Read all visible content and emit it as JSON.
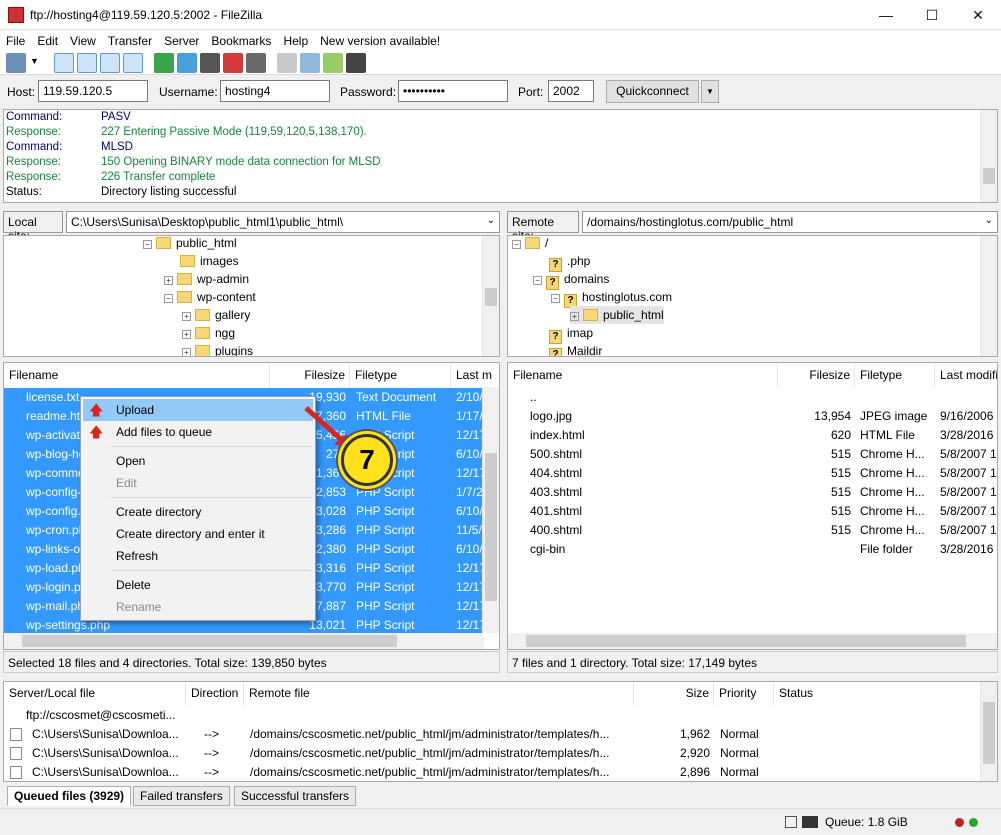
{
  "window": {
    "title": "ftp://hosting4@119.59.120.5:2002 - FileZilla",
    "minimize": "—",
    "maximize": "☐",
    "close": "✕"
  },
  "menu": [
    "File",
    "Edit",
    "View",
    "Transfer",
    "Server",
    "Bookmarks",
    "Help",
    "New version available!"
  ],
  "quickconnect": {
    "host_label": "Host:",
    "host_value": "119.59.120.5",
    "user_label": "Username:",
    "user_value": "hosting4",
    "pass_label": "Password:",
    "pass_value": "••••••••••",
    "port_label": "Port:",
    "port_value": "2002",
    "button": "Quickconnect",
    "dropdown": "▼"
  },
  "log": [
    {
      "key": "Command:",
      "text": "PASV",
      "color": "navy"
    },
    {
      "key": "Response:",
      "text": "227 Entering Passive Mode (119,59,120,5,138,170).",
      "color": "green"
    },
    {
      "key": "Command:",
      "text": "MLSD",
      "color": "navy"
    },
    {
      "key": "Response:",
      "text": "150 Opening BINARY mode data connection for MLSD",
      "color": "green"
    },
    {
      "key": "Response:",
      "text": "226 Transfer complete",
      "color": "green"
    },
    {
      "key": "Status:",
      "text": "Directory listing successful",
      "color": "black"
    }
  ],
  "local": {
    "site_label": "Local site:",
    "path": "C:\\Users\\Sunisa\\Desktop\\public_html1\\public_html\\",
    "tree": [
      "public_html",
      "images",
      "wp-admin",
      "wp-content",
      "gallery",
      "ngg",
      "plugins"
    ],
    "headers": {
      "name": "Filename",
      "size": "Filesize",
      "type": "Filetype",
      "mod": "Last m"
    },
    "files": [
      {
        "name": "license.txt",
        "size": "19,930",
        "type": "Text Document",
        "mod": "2/10/"
      },
      {
        "name": "readme.html",
        "size": "7,360",
        "type": "HTML File",
        "mod": "1/17/"
      },
      {
        "name": "wp-activate.php",
        "size": "5,456",
        "type": "PHP Script",
        "mod": "12/17"
      },
      {
        "name": "wp-blog-header.php",
        "size": "271",
        "type": "PHP Script",
        "mod": "6/10/"
      },
      {
        "name": "wp-comments-post.php",
        "size": "1,369",
        "type": "PHP Script",
        "mod": "12/17"
      },
      {
        "name": "wp-config-sample.php",
        "size": "2,853",
        "type": "PHP Script",
        "mod": "1/7/2"
      },
      {
        "name": "wp-config.php",
        "size": "3,028",
        "type": "PHP Script",
        "mod": "6/10/"
      },
      {
        "name": "wp-cron.php",
        "size": "3,286",
        "type": "PHP Script",
        "mod": "11/5/"
      },
      {
        "name": "wp-links-opml.php",
        "size": "2,380",
        "type": "PHP Script",
        "mod": "6/10/"
      },
      {
        "name": "wp-load.php",
        "size": "3,316",
        "type": "PHP Script",
        "mod": "12/17"
      },
      {
        "name": "wp-login.php",
        "size": "33,770",
        "type": "PHP Script",
        "mod": "12/17"
      },
      {
        "name": "wp-mail.php",
        "size": "7,887",
        "type": "PHP Script",
        "mod": "12/17"
      },
      {
        "name": "wp-settings.php",
        "size": "13,021",
        "type": "PHP Script",
        "mod": "12/17"
      }
    ],
    "status": "Selected 18 files and 4 directories. Total size: 139,850 bytes"
  },
  "remote": {
    "site_label": "Remote site:",
    "path": "/domains/hostinglotus.com/public_html",
    "tree": [
      "/",
      ".php",
      "domains",
      "hostinglotus.com",
      "public_html",
      "imap",
      "Maildir"
    ],
    "headers": {
      "name": "Filename",
      "size": "Filesize",
      "type": "Filetype",
      "mod": "Last modifi"
    },
    "files": [
      {
        "name": "..",
        "size": "",
        "type": "",
        "mod": "",
        "icon": "folder"
      },
      {
        "name": "logo.jpg",
        "size": "13,954",
        "type": "JPEG image",
        "mod": "9/16/2006 9",
        "icon": "file"
      },
      {
        "name": "index.html",
        "size": "620",
        "type": "HTML File",
        "mod": "3/28/2016 8",
        "icon": "file"
      },
      {
        "name": "500.shtml",
        "size": "515",
        "type": "Chrome H...",
        "mod": "5/8/2007 1:",
        "icon": "chrome"
      },
      {
        "name": "404.shtml",
        "size": "515",
        "type": "Chrome H...",
        "mod": "5/8/2007 1:",
        "icon": "chrome"
      },
      {
        "name": "403.shtml",
        "size": "515",
        "type": "Chrome H...",
        "mod": "5/8/2007 1:",
        "icon": "chrome"
      },
      {
        "name": "401.shtml",
        "size": "515",
        "type": "Chrome H...",
        "mod": "5/8/2007 1:",
        "icon": "chrome"
      },
      {
        "name": "400.shtml",
        "size": "515",
        "type": "Chrome H...",
        "mod": "5/8/2007 1:",
        "icon": "chrome"
      },
      {
        "name": "cgi-bin",
        "size": "",
        "type": "File folder",
        "mod": "3/28/2016 8",
        "icon": "folder"
      }
    ],
    "status": "7 files and 1 directory. Total size: 17,149 bytes"
  },
  "context_menu": {
    "upload": "Upload",
    "add_queue": "Add files to queue",
    "open": "Open",
    "edit": "Edit",
    "create_dir": "Create directory",
    "create_dir_enter": "Create directory and enter it",
    "refresh": "Refresh",
    "delete": "Delete",
    "rename": "Rename"
  },
  "callout": "7",
  "queue": {
    "headers": {
      "server": "Server/Local file",
      "direction": "Direction",
      "remote": "Remote file",
      "size": "Size",
      "priority": "Priority",
      "status": "Status"
    },
    "server": "ftp://cscosmet@cscosmeti...",
    "rows": [
      {
        "local": "C:\\Users\\Sunisa\\Downloa...",
        "dir": "-->",
        "remote": "/domains/cscosmetic.net/public_html/jm/administrator/templates/h...",
        "size": "1,962",
        "priority": "Normal"
      },
      {
        "local": "C:\\Users\\Sunisa\\Downloa...",
        "dir": "-->",
        "remote": "/domains/cscosmetic.net/public_html/jm/administrator/templates/h...",
        "size": "2,920",
        "priority": "Normal"
      },
      {
        "local": "C:\\Users\\Sunisa\\Downloa...",
        "dir": "-->",
        "remote": "/domains/cscosmetic.net/public_html/jm/administrator/templates/h...",
        "size": "2,896",
        "priority": "Normal"
      }
    ]
  },
  "tabs": {
    "queued": "Queued files (3929)",
    "failed": "Failed transfers",
    "successful": "Successful transfers"
  },
  "bottom": {
    "queue": "Queue: 1.8 GiB"
  }
}
